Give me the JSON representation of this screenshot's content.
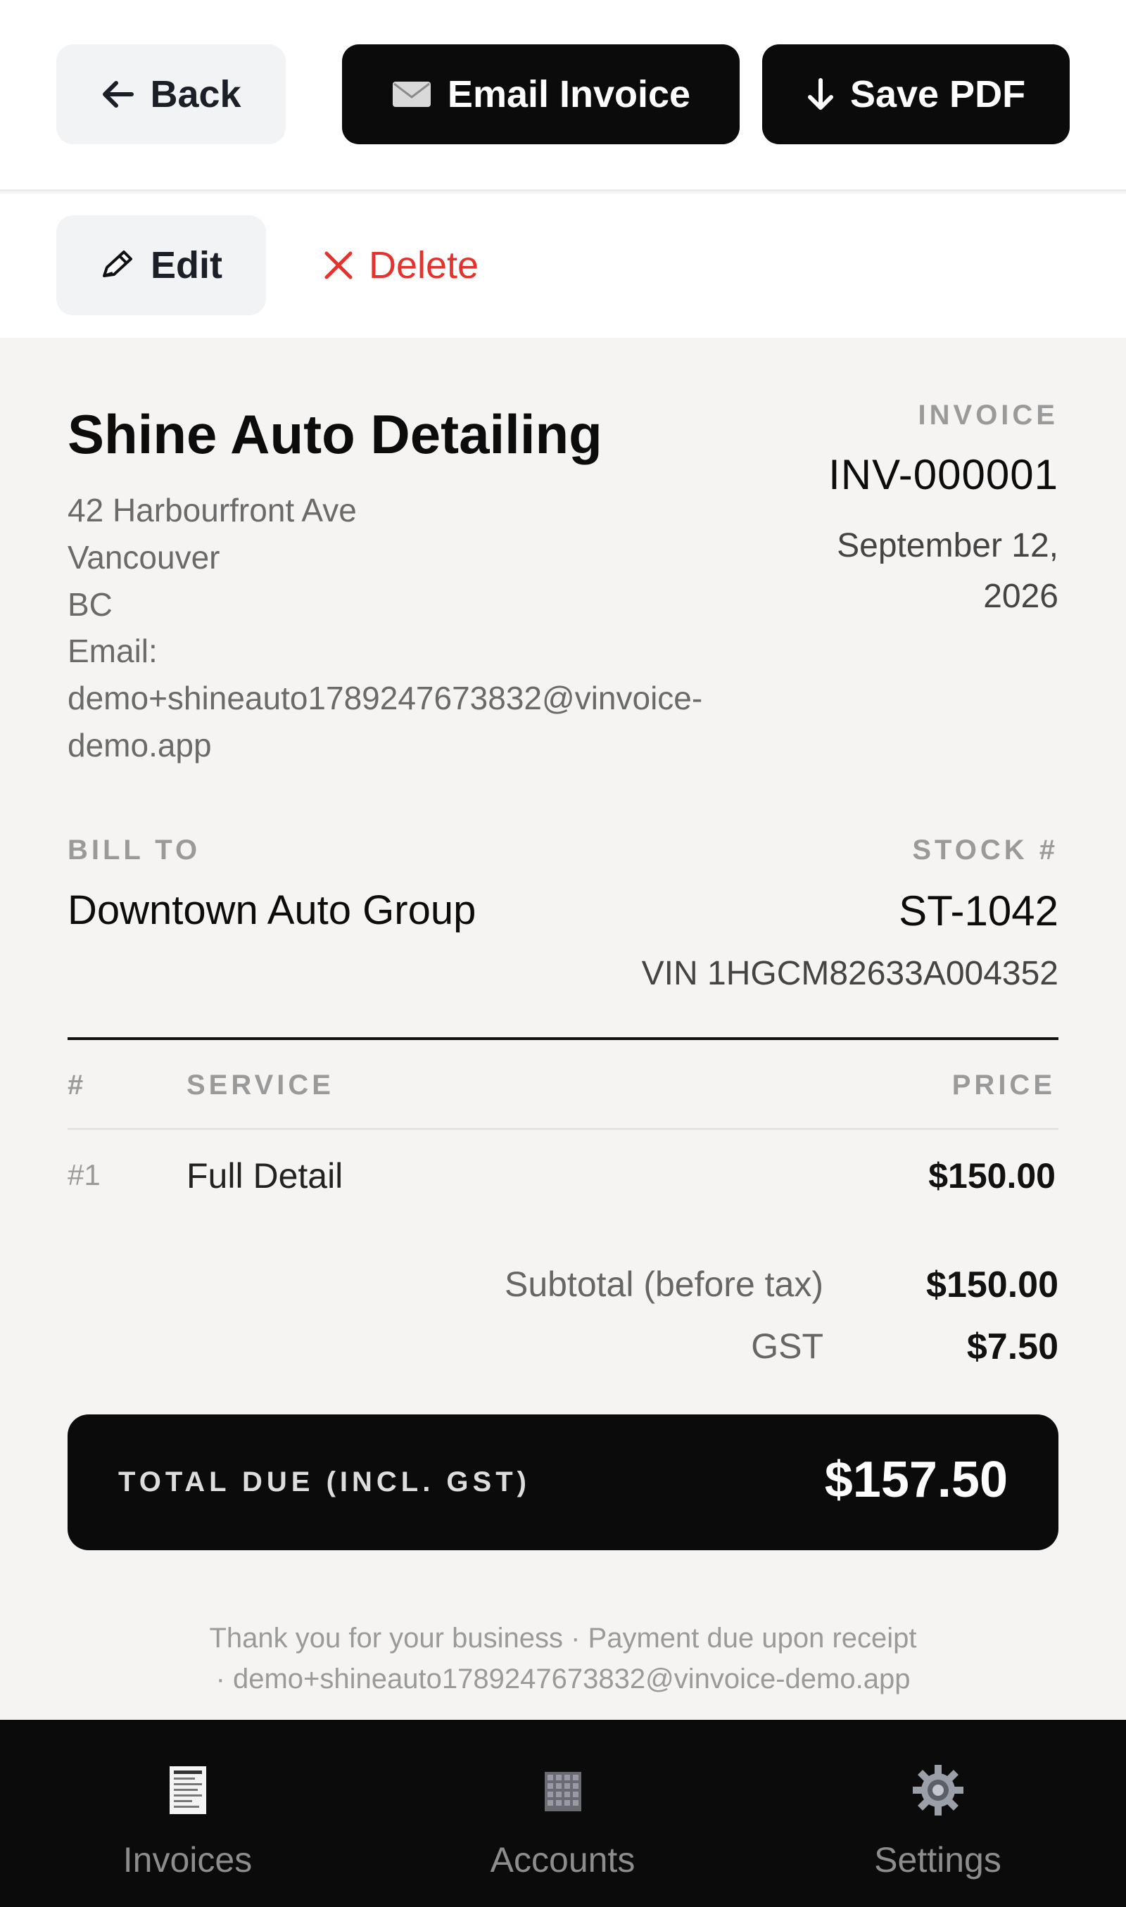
{
  "toolbar": {
    "back_label": "Back",
    "email_label": "Email Invoice",
    "save_pdf_label": "Save PDF",
    "edit_label": "Edit",
    "delete_label": "Delete"
  },
  "business": {
    "name": "Shine Auto Detailing",
    "address": "42 Harbourfront Ave",
    "city": "Vancouver",
    "province": "BC",
    "email_label": "Email:",
    "email_line1": "demo+shineauto1789247673832@vinvoice-",
    "email_line2": "demo.app"
  },
  "invoice": {
    "label": "INVOICE",
    "number": "INV-000001",
    "date_line1": "September 12,",
    "date_line2": "2026"
  },
  "bill_to": {
    "label": "BILL TO",
    "name": "Downtown Auto Group"
  },
  "stock": {
    "label": "STOCK #",
    "number": "ST-1042",
    "vin": "VIN 1HGCM82633A004352"
  },
  "table": {
    "headers": {
      "num": "#",
      "service": "SERVICE",
      "price": "PRICE"
    },
    "rows": [
      {
        "num": "#1",
        "service": "Full Detail",
        "price": "$150.00"
      }
    ]
  },
  "totals": {
    "subtotal_label": "Subtotal (before tax)",
    "subtotal_value": "$150.00",
    "gst_label": "GST",
    "gst_value": "$7.50",
    "due_label": "TOTAL DUE (INCL. GST)",
    "due_value": "$157.50"
  },
  "footer": {
    "line1": "Thank you for your business · Payment due upon receipt",
    "line2": "· demo+shineauto1789247673832@vinvoice-demo.app"
  },
  "nav": {
    "items": [
      {
        "label": "Invoices",
        "icon": "receipt-icon"
      },
      {
        "label": "Accounts",
        "icon": "building-icon"
      },
      {
        "label": "Settings",
        "icon": "gear-icon"
      }
    ]
  },
  "colors": {
    "accent_dark": "#0b0b0b",
    "delete_red": "#e5322d",
    "page_bg": "#f5f4f2"
  }
}
